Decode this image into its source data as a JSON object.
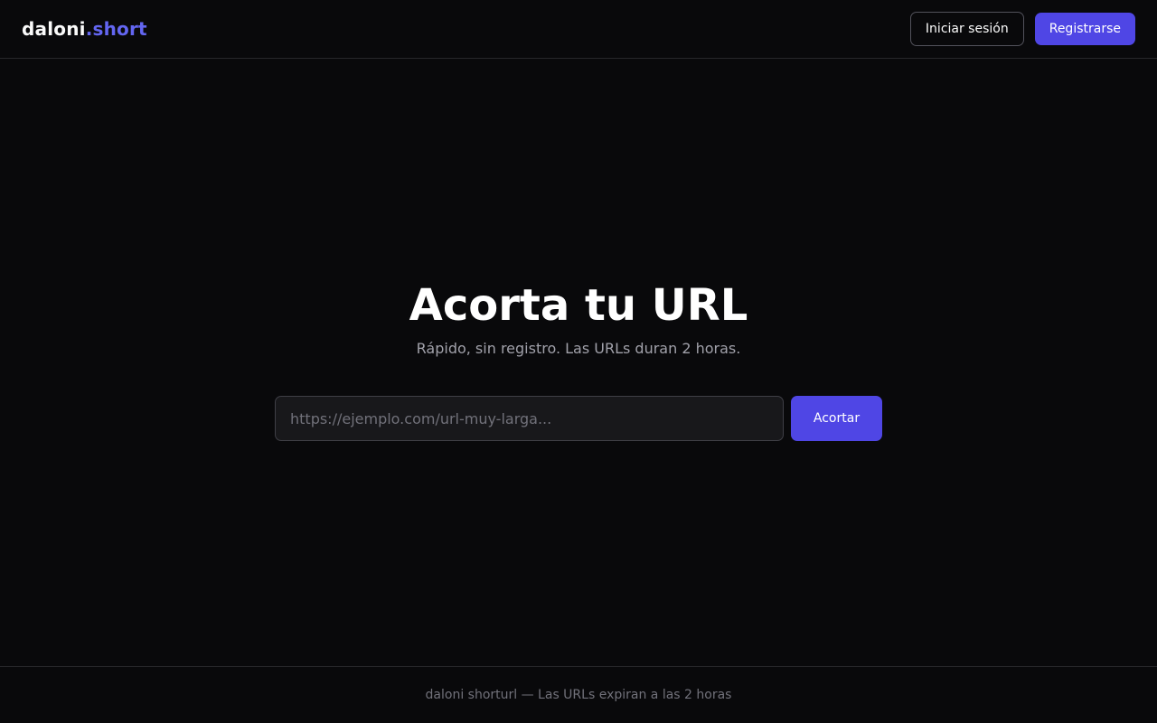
{
  "header": {
    "logo_main": "daloni",
    "logo_accent": ".short",
    "login_label": "Iniciar sesión",
    "register_label": "Registrarse"
  },
  "hero": {
    "title": "Acorta tu URL",
    "subtitle": "Rápido, sin registro. Las URLs duran 2 horas."
  },
  "form": {
    "url_value": "",
    "url_placeholder": "https://ejemplo.com/url-muy-larga...",
    "submit_label": "Acortar"
  },
  "footer": {
    "text": "daloni shorturl — Las URLs expiran a las 2 horas"
  },
  "colors": {
    "background": "#09090b",
    "accent": "#6366f1",
    "primary_button": "#4f46e5",
    "muted_text": "#a1a1aa",
    "border": "#27272a"
  }
}
